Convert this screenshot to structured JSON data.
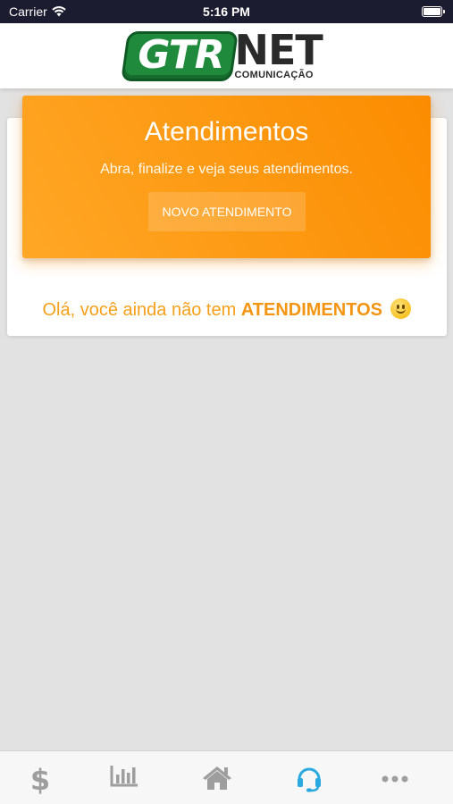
{
  "status_bar": {
    "carrier": "Carrier",
    "time": "5:16 PM"
  },
  "logo": {
    "brand_left": "GTR",
    "brand_right": "NET",
    "tagline": "COMUNICAÇÃO"
  },
  "banner": {
    "title": "Atendimentos",
    "subtitle": "Abra, finalize e veja seus atendimentos.",
    "button_label": "NOVO ATENDIMENTO"
  },
  "empty_message": {
    "prefix": "Olá, você ainda não tem",
    "highlight": "ATENDIMENTOS"
  },
  "tabbar": {
    "items": [
      {
        "icon": "dollar-icon",
        "active": false
      },
      {
        "icon": "bar-chart-icon",
        "active": false
      },
      {
        "icon": "home-icon",
        "active": false
      },
      {
        "icon": "headset-icon",
        "active": true
      },
      {
        "icon": "more-icon",
        "active": false
      }
    ]
  },
  "colors": {
    "accent": "#fb8c00",
    "active_tab": "#2aa9e0",
    "inactive_tab": "#9e9e9e",
    "brand_green": "#1f8a3c"
  }
}
